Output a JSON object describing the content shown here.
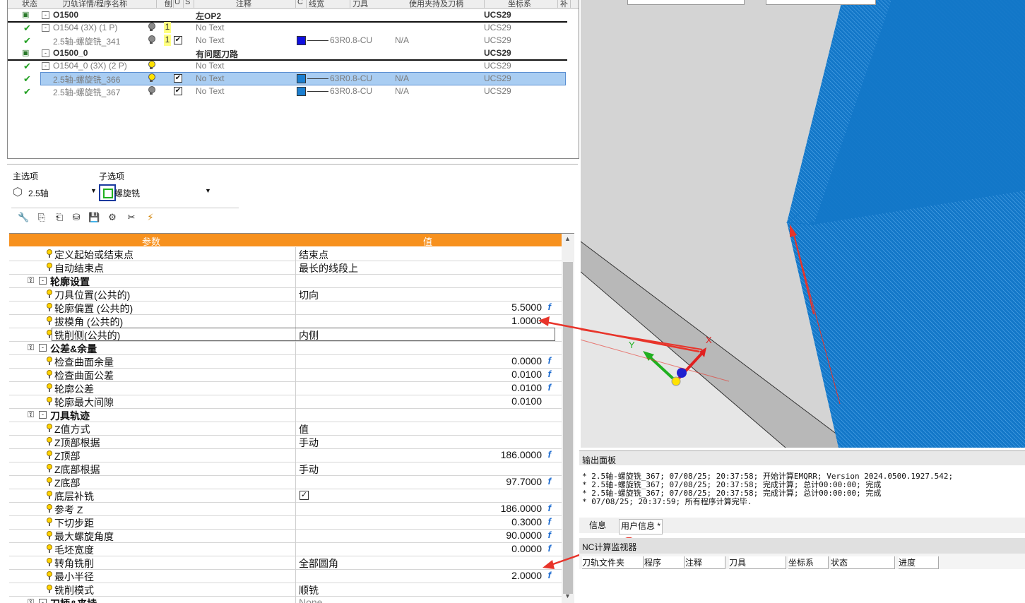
{
  "tree": {
    "headers": [
      "状态",
      "刀轨详情/程序名称",
      "刨",
      "U",
      "S",
      "注释",
      "C",
      "线宽",
      "刀具",
      "使用夹持及刀柄",
      "坐标系",
      "补"
    ],
    "rows": [
      {
        "name": "O1500",
        "comment": "左OP2",
        "ucs": "UCS29"
      },
      {
        "name": "O1504 (3X) (1 P)",
        "comment": "No Text",
        "ucs": "UCS29",
        "u": "1"
      },
      {
        "name": "2.5轴-螺旋铣_341",
        "comment": "No Text",
        "tool": "63R0.8-CU",
        "holder": "N/A",
        "ucs": "UCS29",
        "u": "1"
      },
      {
        "name": "O1500_0",
        "comment": "有问题刀路",
        "ucs": "UCS29"
      },
      {
        "name": "O1504_0 (3X) (2 P)",
        "comment": "No Text",
        "ucs": "UCS29"
      },
      {
        "name": "2.5轴-螺旋铣_366",
        "comment": "No Text",
        "tool": "63R0.8-CU",
        "holder": "N/A",
        "ucs": "UCS29"
      },
      {
        "name": "2.5轴-螺旋铣_367",
        "comment": "No Text",
        "tool": "63R0.8-CU",
        "holder": "N/A",
        "ucs": "UCS29"
      }
    ],
    "colors": {
      "tool_blue": "#1010e0",
      "tool_lightblue": "#1c7fd0",
      "selected": "#a9cdf2"
    }
  },
  "options": {
    "main_label": "主选项",
    "sub_label": "子选项",
    "main_value": "2.5轴",
    "sub_value": "螺旋铣"
  },
  "grid": {
    "col_param": "参数",
    "col_value": "值",
    "rows": [
      {
        "name": "定义起始或结束点",
        "value": "结束点"
      },
      {
        "name": "自动结束点",
        "value": "最长的线段上"
      },
      {
        "name": "轮廓设置",
        "section": true
      },
      {
        "name": "刀具位置(公共的)",
        "value": "切向"
      },
      {
        "name": "轮廓偏置  (公共的)",
        "num": "5.5000",
        "fx": "f"
      },
      {
        "name": "拔模角 (公共的)",
        "num": "1.0000"
      },
      {
        "name": "铣削侧(公共的)",
        "value": "内侧"
      },
      {
        "name": "公差&余量",
        "section": true
      },
      {
        "name": "检查曲面余量",
        "num": "0.0000",
        "fx": "f"
      },
      {
        "name": "检查曲面公差",
        "num": "0.0100",
        "fx": "f"
      },
      {
        "name": "轮廓公差",
        "num": "0.0100",
        "fx": "f"
      },
      {
        "name": "轮廓最大间隙",
        "num": "0.0100"
      },
      {
        "name": "刀具轨迹",
        "section": true
      },
      {
        "name": "Z值方式",
        "value": "值"
      },
      {
        "name": "Z顶部根据",
        "value": "手动"
      },
      {
        "name": "Z顶部",
        "num": "186.0000",
        "fx": "f"
      },
      {
        "name": "Z底部根据",
        "value": "手动"
      },
      {
        "name": "Z底部",
        "num": "97.7000",
        "fx": "f"
      },
      {
        "name": "底层补铣",
        "checkbox": "✓"
      },
      {
        "name": "参考 Z",
        "num": "186.0000",
        "fx": "f"
      },
      {
        "name": "下切步距",
        "num": "0.3000",
        "fx": "f"
      },
      {
        "name": "最大螺旋角度",
        "num": "90.0000",
        "fx": "f"
      },
      {
        "name": "毛坯宽度",
        "num": "0.0000",
        "fx": "f"
      },
      {
        "name": "转角铣削",
        "value": "全部圆角"
      },
      {
        "name": "最小半径",
        "num": "2.0000",
        "fx": "f"
      },
      {
        "name": "铣削模式",
        "value": "顺铣"
      },
      {
        "name": "刀柄&夹持",
        "section": true,
        "value": "None"
      }
    ],
    "colors": {
      "header": "#f7911e",
      "fx": "#1a6ad0"
    }
  },
  "viewport": {
    "axis_x": "X",
    "axis_y": "Y",
    "colors": {
      "background": "#d4d4d4",
      "toolpath": "#1377c8",
      "wall": "#b8b8b8",
      "arrow": "#e8342a"
    }
  },
  "output": {
    "title": "输出面板",
    "lines": [
      "* 2.5轴-螺旋铣_367; 07/08/25; 20:37:58; 开始计算EMQRR; Version 2024.0500.1927.542;",
      "* 2.5轴-螺旋铣_367; 07/08/25; 20:37:58; 完成计算;  总计00:00:00; 完成",
      "* 2.5轴-螺旋铣_367; 07/08/25; 20:37:58; 完成计算;  总计00:00:00; 完成",
      "* 07/08/25; 20:37:59; 所有程序计算完毕."
    ],
    "tabs": [
      "信息",
      "用户信息 *"
    ]
  },
  "nc": {
    "title": "NC计算监视器",
    "headers": [
      "刀轨文件夹",
      "程序",
      "注释",
      "刀具",
      "坐标系",
      "状态",
      "进度"
    ]
  }
}
